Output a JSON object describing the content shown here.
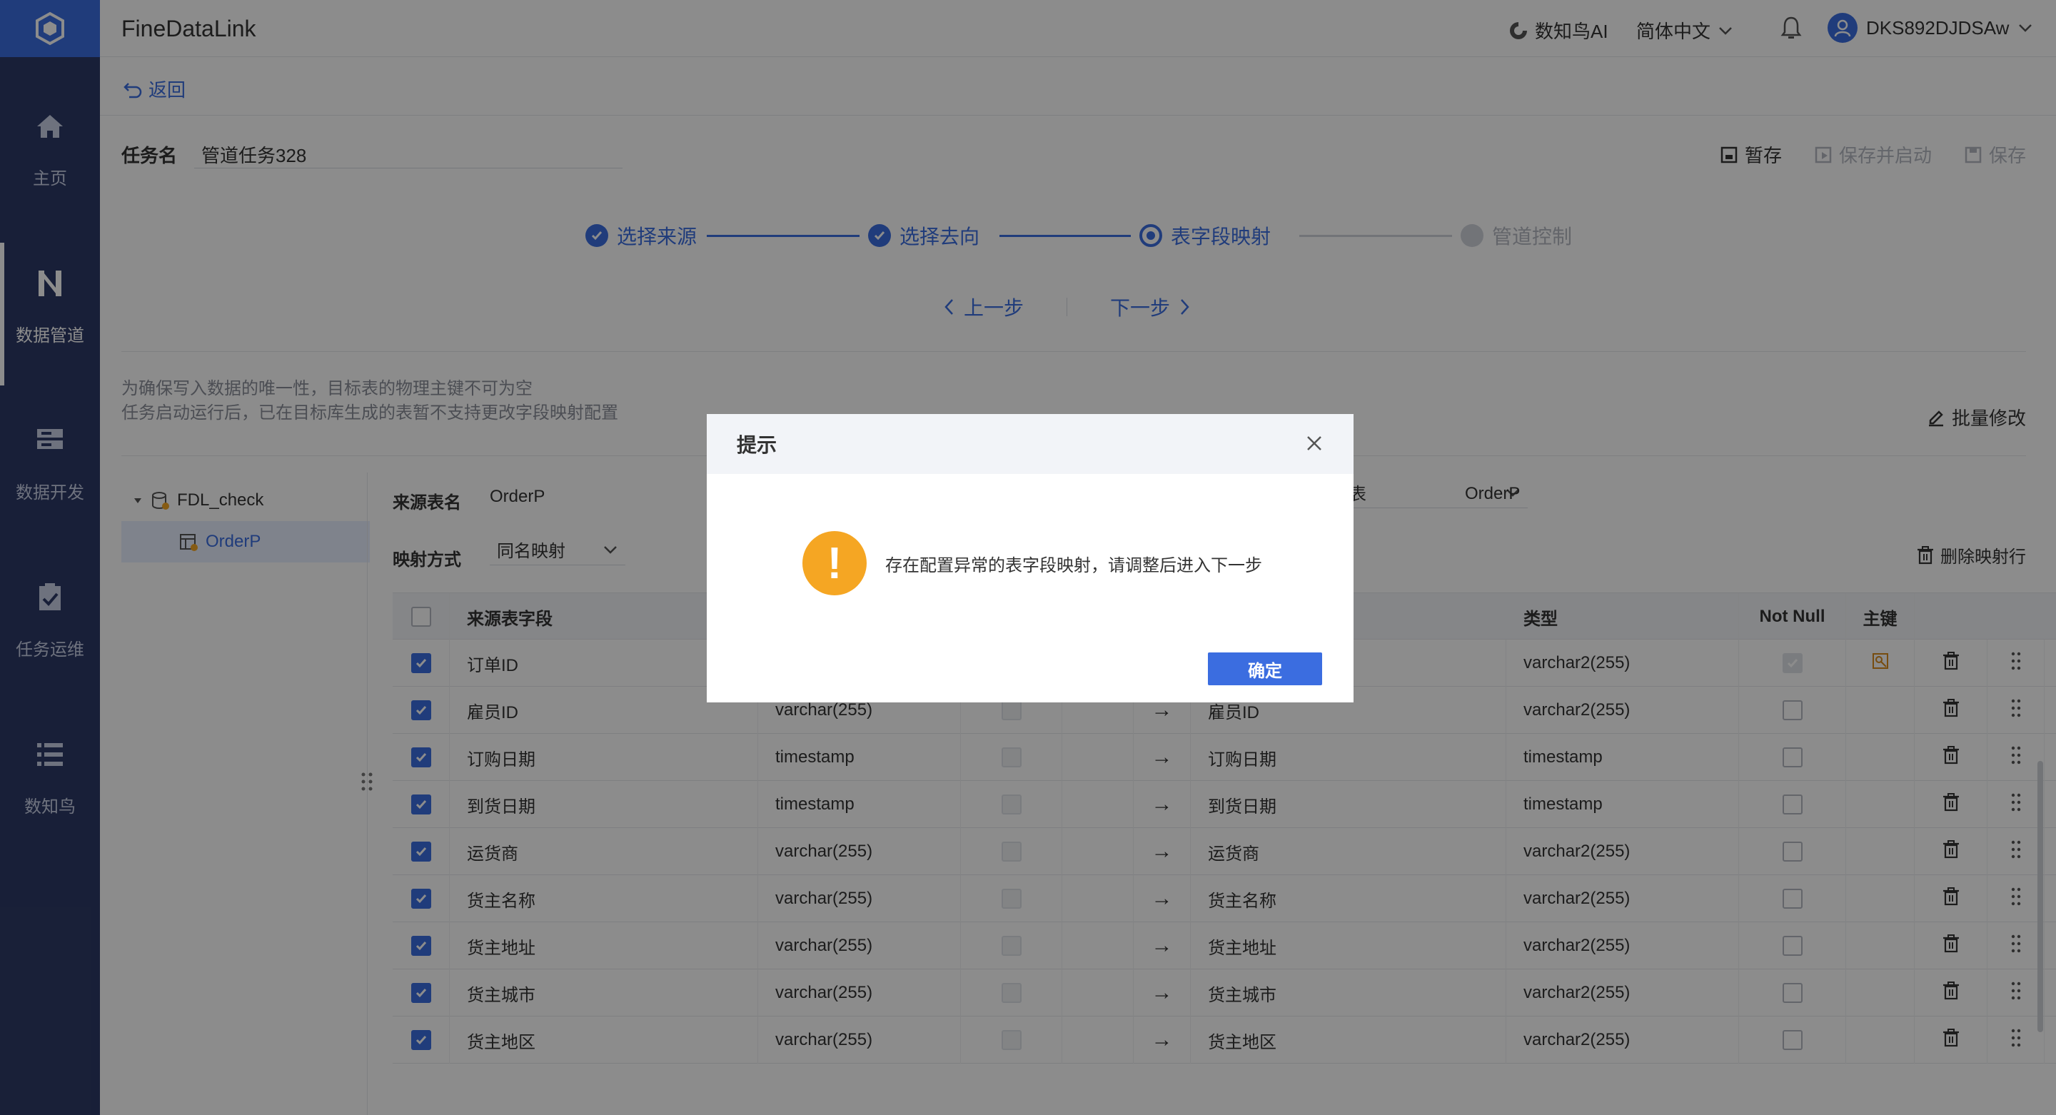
{
  "app": {
    "title": "FineDataLink"
  },
  "sidebar": {
    "items": [
      {
        "label": "主页",
        "icon": "home-icon"
      },
      {
        "label": "数据管道",
        "icon": "pipeline-icon",
        "active": true
      },
      {
        "label": "数据开发",
        "icon": "dev-icon"
      },
      {
        "label": "任务运维",
        "icon": "ops-icon"
      },
      {
        "label": "数知鸟",
        "icon": "list-icon"
      }
    ]
  },
  "topbar": {
    "ai_label": "数知鸟AI",
    "lang_label": "简体中文",
    "user_name": "DKS892DJDSAw"
  },
  "back": {
    "label": "返回"
  },
  "task": {
    "name_label": "任务名",
    "name_value": "管道任务328",
    "actions": {
      "draft": "暂存",
      "save_start": "保存并启动",
      "save": "保存"
    }
  },
  "steps": [
    {
      "label": "选择来源",
      "state": "done"
    },
    {
      "label": "选择去向",
      "state": "done"
    },
    {
      "label": "表字段映射",
      "state": "current"
    },
    {
      "label": "管道控制",
      "state": "pending"
    }
  ],
  "nav": {
    "prev": "上一步",
    "next": "下一步"
  },
  "hints": {
    "line1": "为确保写入数据的唯一性，目标表的物理主键不可为空",
    "line2": "任务启动运行后，已在目标库生成的表暂不支持更改字段映射配置"
  },
  "bulk_edit": "批量修改",
  "tree": {
    "root": "FDL_check",
    "child": "OrderP"
  },
  "form": {
    "source_table_label": "来源表名",
    "source_table_value": "OrderP",
    "target_mode_partial": "表",
    "target_table_value": "OrderP",
    "mapping_label": "映射方式",
    "mapping_value": "同名映射",
    "delete_rows": "删除映射行"
  },
  "table": {
    "headers": {
      "source_field": "来源表字段",
      "type": "类型",
      "not_null": "Not Null",
      "pk": "主键"
    },
    "rows": [
      {
        "src": "订单ID",
        "src_type": "",
        "dst": "",
        "dst_type": "varchar2(255)",
        "pk": true,
        "nn_disabled": true
      },
      {
        "src": "雇员ID",
        "src_type": "varchar(255)",
        "dst": "雇员ID",
        "dst_type": "varchar2(255)"
      },
      {
        "src": "订购日期",
        "src_type": "timestamp",
        "dst": "订购日期",
        "dst_type": "timestamp"
      },
      {
        "src": "到货日期",
        "src_type": "timestamp",
        "dst": "到货日期",
        "dst_type": "timestamp"
      },
      {
        "src": "运货商",
        "src_type": "varchar(255)",
        "dst": "运货商",
        "dst_type": "varchar2(255)"
      },
      {
        "src": "货主名称",
        "src_type": "varchar(255)",
        "dst": "货主名称",
        "dst_type": "varchar2(255)"
      },
      {
        "src": "货主地址",
        "src_type": "varchar(255)",
        "dst": "货主地址",
        "dst_type": "varchar2(255)"
      },
      {
        "src": "货主城市",
        "src_type": "varchar(255)",
        "dst": "货主城市",
        "dst_type": "varchar2(255)"
      },
      {
        "src": "货主地区",
        "src_type": "varchar(255)",
        "dst": "货主地区",
        "dst_type": "varchar2(255)"
      }
    ],
    "arrow": "→"
  },
  "modal": {
    "title": "提示",
    "message": "存在配置异常的表字段映射，请调整后进入下一步",
    "ok": "确定",
    "warn_glyph": "!"
  },
  "colors": {
    "accent": "#3b6de0",
    "sidebar": "#2d3a66",
    "warning": "#f5a623"
  }
}
